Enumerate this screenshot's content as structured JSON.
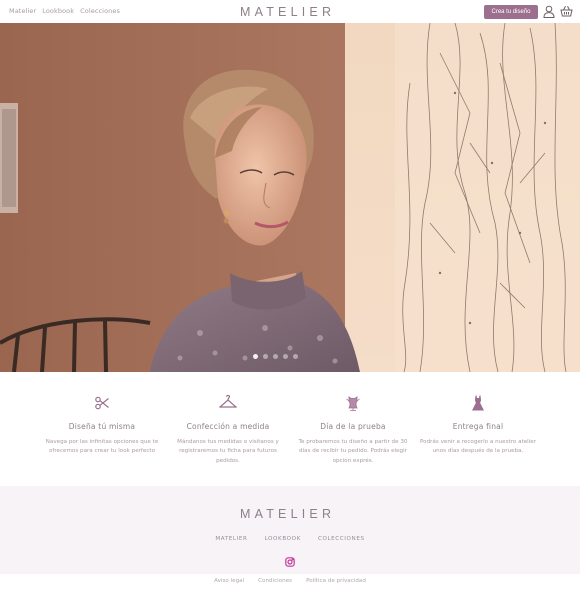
{
  "header": {
    "nav": [
      "Matelier",
      "Lookbook",
      "Colecciones"
    ],
    "logo": "MATELIER",
    "cta_label": "Crea tu diseño",
    "icons": [
      "user-icon",
      "basket-icon"
    ]
  },
  "hero": {
    "carousel_total": 5,
    "carousel_active": 1
  },
  "features": [
    {
      "icon": "scissors-icon",
      "title": "Diseña tú misma",
      "text": "Navega por las infinitas opciones que te ofrecemos para crear tu look perfecto"
    },
    {
      "icon": "hanger-icon",
      "title": "Confección a medida",
      "text": "Mándanos tus medidas o visítanos y registraremos tu ficha para futuros pedidos."
    },
    {
      "icon": "mannequin-icon",
      "title": "Día de la prueba",
      "text": "Te probaremos tu diseño a partir de 30 días de recibir tu pedido. Podrás elegir opción exprés."
    },
    {
      "icon": "dress-icon",
      "title": "Entrega final",
      "text": "Podrás venir a recogerlo a nuestro atelier unos días después de la prueba."
    }
  ],
  "footer": {
    "logo": "MATELIER",
    "nav": [
      "MATELIER",
      "LOOKBOOK",
      "COLECCIONES"
    ],
    "social_icon": "instagram-icon",
    "legal": [
      "Aviso legal",
      "Condiciones",
      "Política de privacidad"
    ]
  },
  "colors": {
    "accent": "#9c6f8f",
    "text": "#8e7f89",
    "instagram": "#c2389a",
    "footer_bg": "#f8f3f7"
  }
}
